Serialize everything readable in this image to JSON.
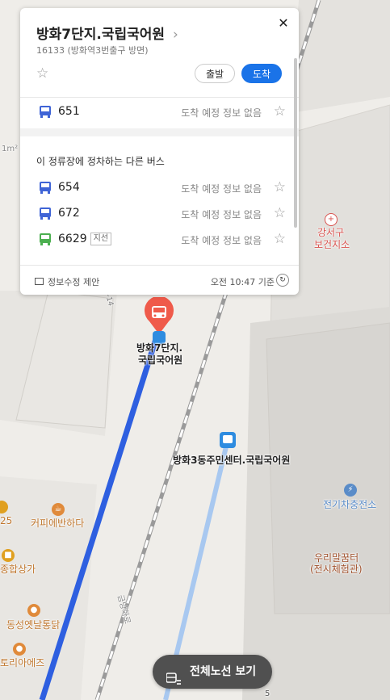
{
  "stop": {
    "name": "방화7단지.국립국어원",
    "name_arrow": "›",
    "subtitle": "16133 (방화역3번출구 방면)",
    "close_icon": "✕",
    "favorite_icon": "☆",
    "depart_label": "출발",
    "arrive_label": "도착"
  },
  "main_route": {
    "number": "651",
    "status": "도착 예정 정보 없음",
    "color": "#3f64d6"
  },
  "other_section_title": "이 정류장에 정차하는 다른 버스",
  "other_routes": [
    {
      "number": "654",
      "status": "도착 예정 정보 없음",
      "badge": "",
      "color": "#3f64d6"
    },
    {
      "number": "672",
      "status": "도착 예정 정보 없음",
      "badge": "",
      "color": "#3f64d6"
    },
    {
      "number": "6629",
      "status": "도착 예정 정보 없음",
      "badge": "지선",
      "color": "#4caf50"
    }
  ],
  "footer": {
    "feedback_label": "정보수정 제안",
    "updated_time": "오전 10:47 기준",
    "refresh_icon": "↻"
  },
  "map": {
    "selected_stop_label_1": "방화7단지.",
    "selected_stop_label_2": "국립국어원",
    "other_stop_label": "방화3동주민센터.국립국어원",
    "pois": [
      {
        "name": "강서구",
        "sub": "보건지소",
        "color": "#d9534f"
      },
      {
        "name": "전기차충전소",
        "sub": "",
        "color": "#5a8cc8"
      },
      {
        "name": "우리말꿈터",
        "sub": "(전시체험관)",
        "color": "#a0522d"
      },
      {
        "name": "커피에반하다",
        "sub": "",
        "color": "#c08030"
      },
      {
        "name": "종합상가",
        "sub": "",
        "color": "#c08030"
      },
      {
        "name": "동성옛날통닭",
        "sub": "",
        "color": "#c08030"
      },
      {
        "name": "토리아에즈",
        "sub": "",
        "color": "#c08030"
      }
    ],
    "partial_labels": [
      "25",
      "5"
    ],
    "road_label_1": "1-14",
    "road_label_2": "금낭화로",
    "area_label": "1m²",
    "route_color": "#2e5fe0",
    "route_light_color": "#a8c8f0"
  },
  "bottom_button": {
    "label": "전체노선 보기",
    "icon": "bus-route-icon"
  }
}
